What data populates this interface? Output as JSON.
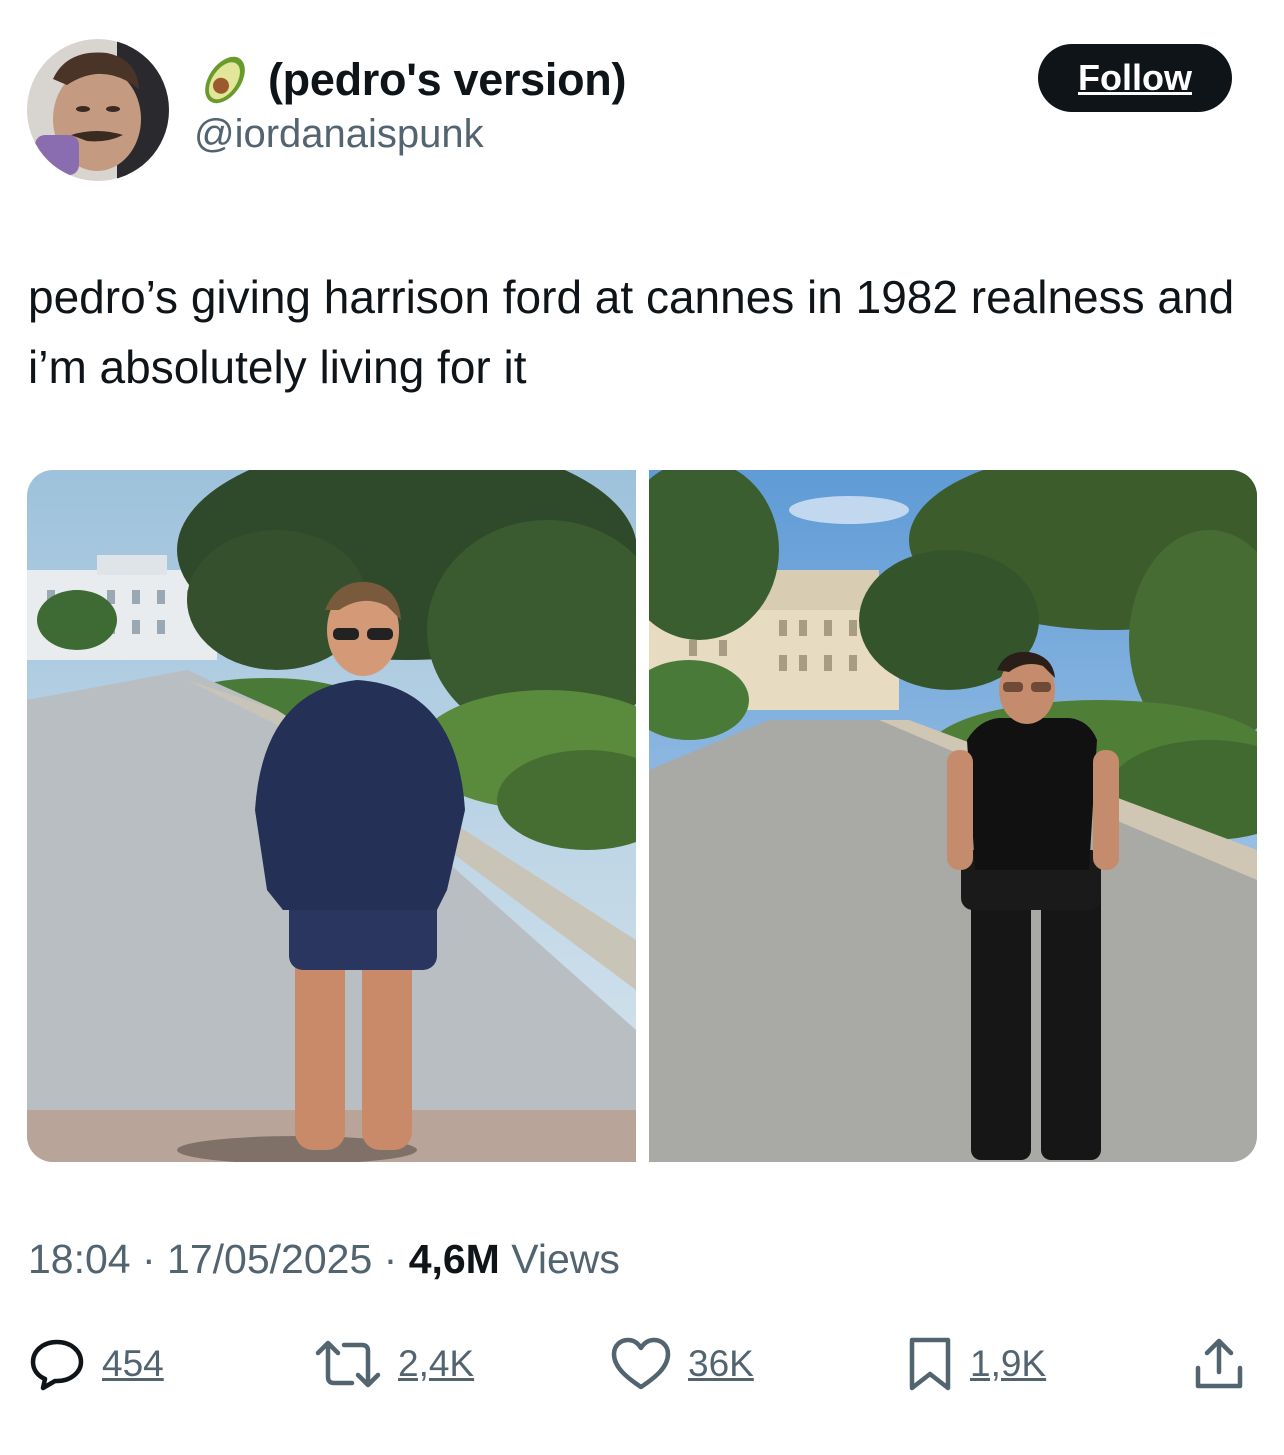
{
  "author": {
    "display_name": "(pedro's version)",
    "handle": "@iordanaispunk",
    "emoji": "avocado"
  },
  "follow_label": "Follow",
  "tweet": {
    "text": "pedro’s giving harrison ford at cannes in 1982 realness and i’m absolutely living for it"
  },
  "meta": {
    "time": "18:04",
    "sep1": " · ",
    "date": "17/05/2025",
    "sep2": " · ",
    "views_count": "4,6M",
    "views_label": " Views"
  },
  "actions": {
    "replies": "454",
    "reposts": "2,4K",
    "likes": "36K",
    "bookmarks": "1,9K"
  },
  "colors": {
    "text": "#0f1419",
    "secondary": "#536471",
    "button_bg": "#0f1419"
  }
}
